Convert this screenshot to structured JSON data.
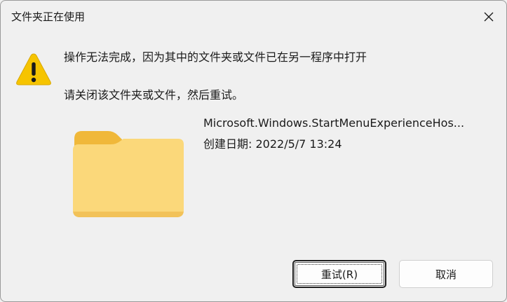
{
  "window": {
    "title": "文件夹正在使用",
    "close_icon": "close-icon"
  },
  "message": {
    "main": "操作无法完成，因为其中的文件夹或文件已在另一程序中打开",
    "sub": "请关闭该文件夹或文件，然后重试。",
    "icon": "warning-icon"
  },
  "item": {
    "icon": "folder-icon",
    "name": "Microsoft.Windows.StartMenuExperienceHos...",
    "date": "创建日期: 2022/5/7 13:24"
  },
  "buttons": {
    "retry_label": "重试(R)",
    "cancel_label": "取消"
  },
  "colors": {
    "background": "#f0f0f0",
    "warning_yellow": "#f6c400",
    "folder_front": "#fbd87a",
    "folder_back": "#f0b83a"
  }
}
